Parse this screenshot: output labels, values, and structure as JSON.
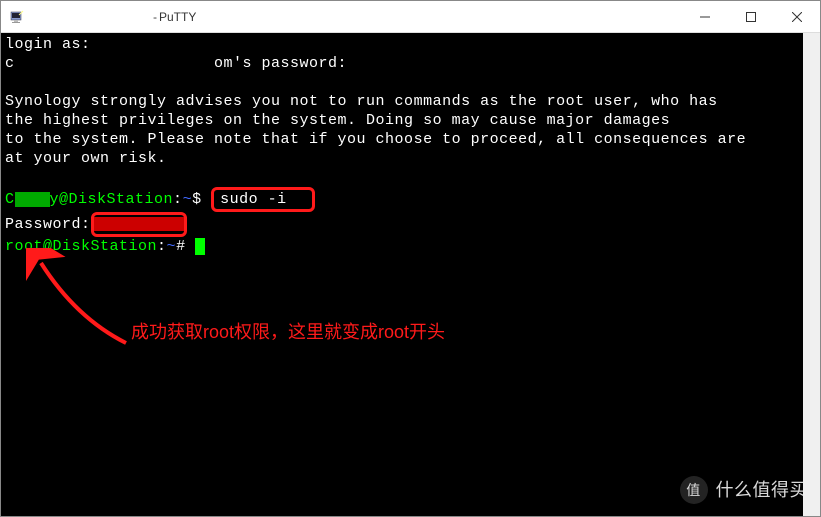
{
  "titlebar": {
    "separator": " - ",
    "app_name": "PuTTY"
  },
  "window_controls": {
    "minimize": "—",
    "maximize": "☐",
    "close": "✕"
  },
  "terminal": {
    "login_prompt": "login as: ",
    "password_prompt_prefix": "c",
    "password_prompt_suffix": "om's password:",
    "warning_line1": "Synology strongly advises you not to run commands as the root user, who has",
    "warning_line2": "the highest privileges on the system. Doing so may cause major damages",
    "warning_line3": "to the system. Please note that if you choose to proceed, all consequences are",
    "warning_line4": "at your own risk.",
    "user_prompt_prefix": "C",
    "user_prompt_host": "y@DiskStation",
    "user_prompt_colon": ":",
    "user_prompt_path": "~",
    "user_prompt_dollar": "$ ",
    "sudo_command": "sudo -i",
    "password_line": "Password:",
    "root_prompt_host": "root@DiskStation",
    "root_prompt_colon": ":",
    "root_prompt_path": "~",
    "root_prompt_hash": "# "
  },
  "annotation": {
    "text": "成功获取root权限，这里就变成root开头"
  },
  "watermark": {
    "circle": "值",
    "text": "什么值得买"
  }
}
